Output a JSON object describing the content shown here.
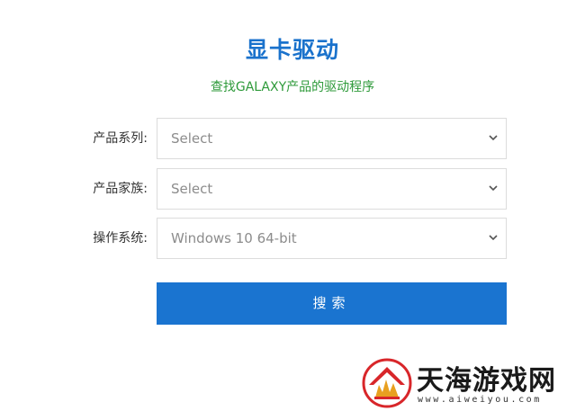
{
  "header": {
    "title": "显卡驱动",
    "subtitle": "查找GALAXY产品的驱动程序"
  },
  "form": {
    "fields": [
      {
        "label": "产品系列:",
        "value": "Select"
      },
      {
        "label": "产品家族:",
        "value": "Select"
      },
      {
        "label": "操作系统:",
        "value": "Windows 10 64-bit"
      }
    ],
    "search_label": "搜索"
  },
  "watermark": {
    "name": "天海游戏网",
    "url": "www.aiweiyou.com"
  },
  "colors": {
    "title": "#1a72cc",
    "subtitle": "#2e9a3a",
    "button": "#1a74d0",
    "logo_red": "#d8262a",
    "logo_gold": "#e8a020"
  },
  "icons": {
    "select_arrow": "chevron-down-icon",
    "logo": "house-flame-logo-icon"
  }
}
